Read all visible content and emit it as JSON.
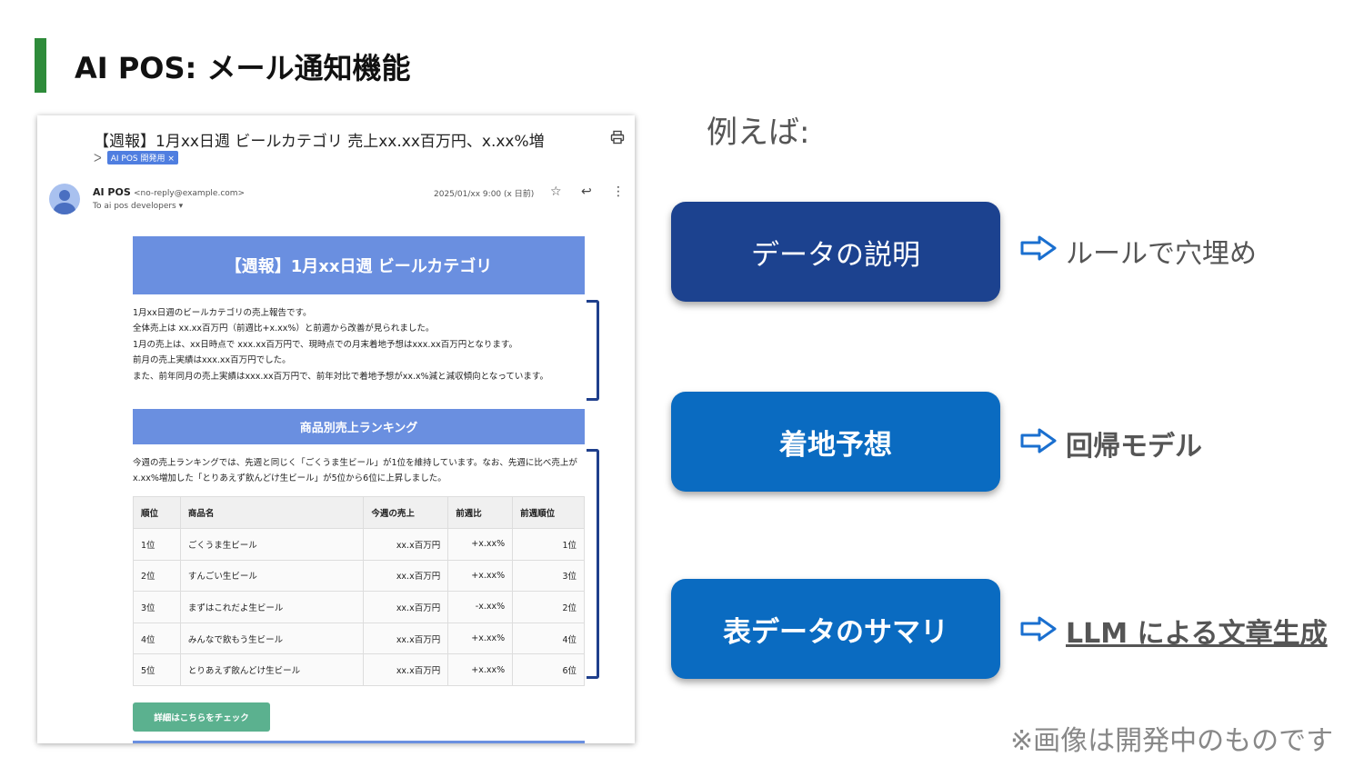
{
  "slide": {
    "title": "AI POS: メール通知機能",
    "accent_color": "#2e8b3a"
  },
  "email": {
    "subject": "【週報】1月xx日週 ビールカテゴリ 売上xx.xx百万円、x.xx%増",
    "label_tag": "AI POS 開発用 ×",
    "sender_name": "AI POS",
    "sender_address": "<no-reply@example.com>",
    "recipient": "To ai pos developers ▾",
    "date": "2025/01/xx 9:00 (x 日前)",
    "header_title": "【週報】1月xx日週 ビールカテゴリ",
    "summary_lines": [
      "1月xx日週のビールカテゴリの売上報告です。",
      "全体売上は xx.xx百万円（前週比+x.xx%）と前週から改善が見られました。",
      "1月の売上は、xx日時点で xxx.xx百万円で、現時点での月末着地予想はxxx.xx百万円となります。",
      "前月の売上実績はxxx.xx百万円でした。",
      "また、前年同月の売上実績はxxx.xx百万円で、前年対比で着地予想がxx.x%減と減収傾向となっています。"
    ],
    "ranking_title": "商品別売上ランキング",
    "ranking_text": "今週の売上ランキングでは、先週と同じく「ごくうま生ビール」が1位を維持しています。なお、先週に比べ売上がx.xx%増加した「とりあえず飲んどけ生ビール」が5位から6位に上昇しました。",
    "table": {
      "headers": [
        "順位",
        "商品名",
        "今週の売上",
        "前週比",
        "前週順位"
      ],
      "rows": [
        [
          "1位",
          "ごくうま生ビール",
          "xx.x百万円",
          "+x.xx%",
          "1位"
        ],
        [
          "2位",
          "すんごい生ビール",
          "xx.x百万円",
          "+x.xx%",
          "3位"
        ],
        [
          "3位",
          "まずはこれだよ生ビール",
          "xx.x百万円",
          "-x.xx%",
          "2位"
        ],
        [
          "4位",
          "みんなで飲もう生ビール",
          "xx.x百万円",
          "+x.xx%",
          "4位"
        ],
        [
          "5位",
          "とりあえず飲んどけ生ビール",
          "xx.x百万円",
          "+x.xx%",
          "6位"
        ]
      ]
    },
    "check_button": "詳細はこちらをチェック"
  },
  "features": {
    "intro": "例えば:",
    "items": [
      {
        "label": "データの説明",
        "result": "ルールで穴埋め"
      },
      {
        "label": "着地予想",
        "result": "回帰モデル"
      },
      {
        "label": "表データのサマリ",
        "result": "LLM による文章生成"
      }
    ],
    "note": "※画像は開発中のものです"
  }
}
